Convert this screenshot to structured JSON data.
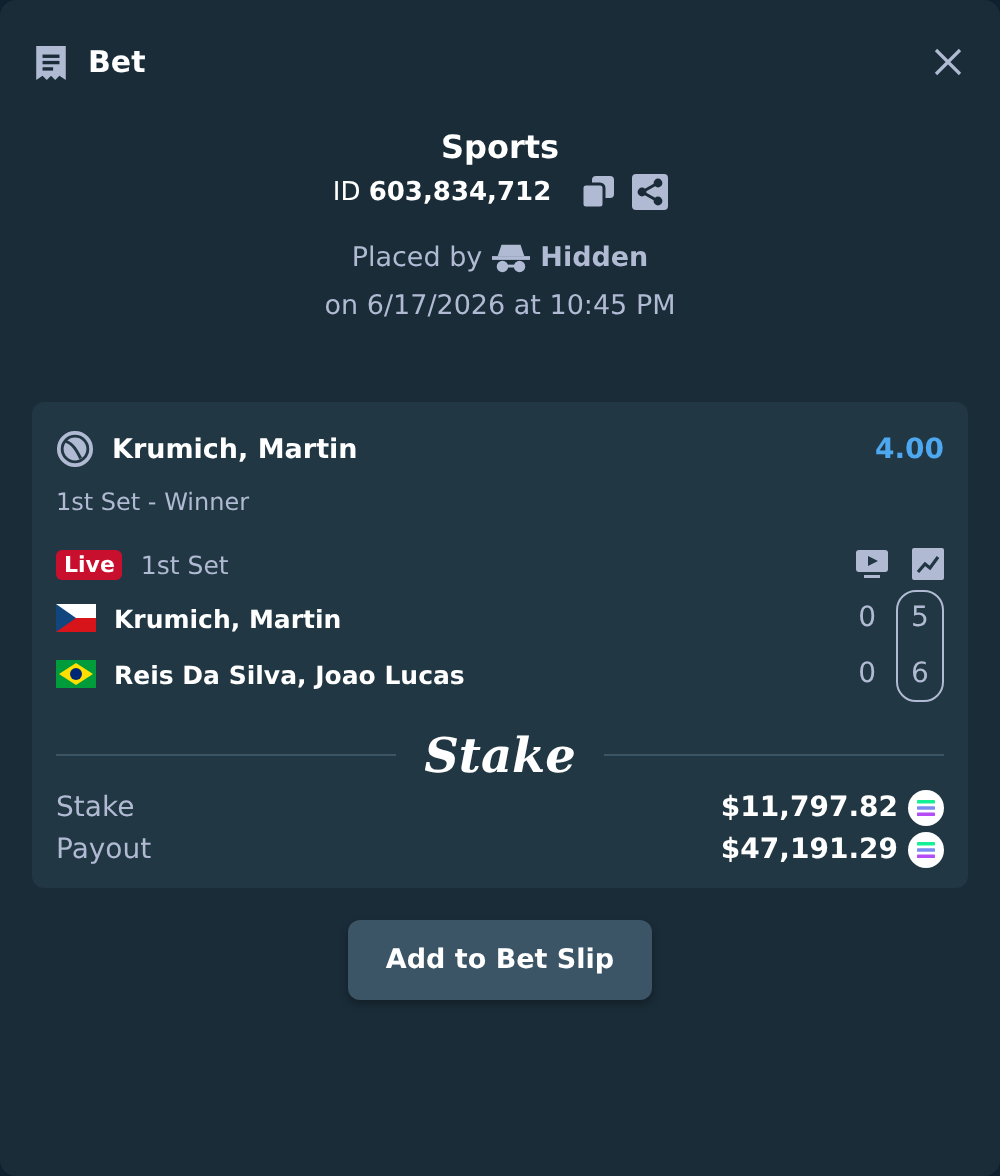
{
  "header": {
    "title": "Bet"
  },
  "summary": {
    "category": "Sports",
    "bet_id": "ID **603,834,712**",
    "placed_by_label": "Placed by",
    "placed_by_user": "Hidden",
    "placed_on": "on 6/17/2026 at 10:45 PM"
  },
  "selection": {
    "name": "Krumich, Martin",
    "odds": "4.00",
    "market": "1st Set - Winner"
  },
  "match": {
    "live_badge": "Live",
    "period": "1st Set",
    "players": [
      {
        "name": "Krumich, Martin",
        "game_score": "0",
        "set_score": "5"
      },
      {
        "name": "Reis Da Silva, Joao Lucas",
        "game_score": "0",
        "set_score": "6"
      }
    ]
  },
  "brand": "Stake",
  "amounts": [
    {
      "label": "Stake",
      "value": "$11,797.82"
    },
    {
      "label": "Payout",
      "value": "$47,191.29"
    }
  ],
  "action_button": "Add to Bet Slip"
}
